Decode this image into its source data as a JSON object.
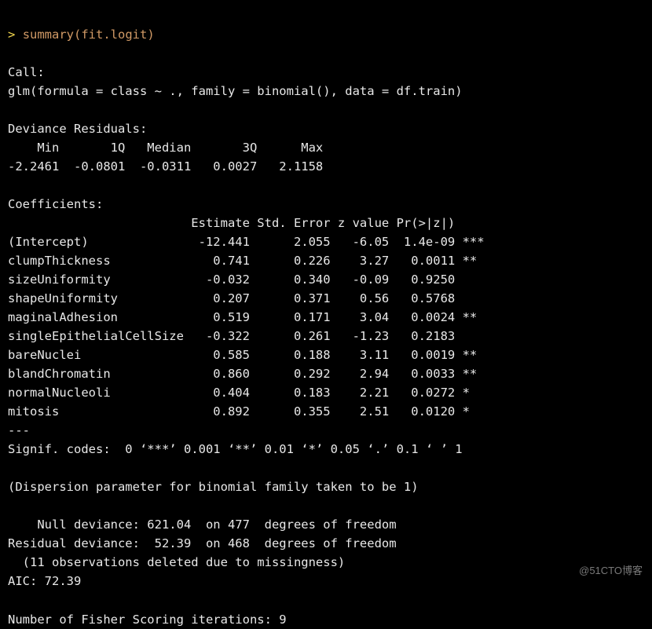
{
  "prompt": {
    "symbol": ">",
    "command": "summary(fit.logit)"
  },
  "call": {
    "header": "Call:",
    "formula": "glm(formula = class ~ ., family = binomial(), data = df.train)"
  },
  "devres": {
    "header": "Deviance Residuals: ",
    "labels": "    Min       1Q   Median       3Q      Max  ",
    "values": "-2.2461  -0.0801  -0.0311   0.0027   2.1158  "
  },
  "coef": {
    "header": "Coefficients:",
    "colhead": "                         Estimate Std. Error z value Pr(>|z|)    ",
    "rows": [
      "(Intercept)               -12.441      2.055   -6.05  1.4e-09 ***",
      "clumpThickness              0.741      0.226    3.27   0.0011 ** ",
      "sizeUniformity             -0.032      0.340   -0.09   0.9250    ",
      "shapeUniformity             0.207      0.371    0.56   0.5768    ",
      "maginalAdhesion             0.519      0.171    3.04   0.0024 ** ",
      "singleEpithelialCellSize   -0.322      0.261   -1.23   0.2183    ",
      "bareNuclei                  0.585      0.188    3.11   0.0019 ** ",
      "blandChromatin              0.860      0.292    2.94   0.0033 ** ",
      "normalNucleoli              0.404      0.183    2.21   0.0272 *  ",
      "mitosis                     0.892      0.355    2.51   0.0120 *  "
    ]
  },
  "signif": {
    "sep": "---",
    "codes": "Signif. codes:  0 ‘***’ 0.001 ‘**’ 0.01 ‘*’ 0.05 ‘.’ 0.1 ‘ ’ 1"
  },
  "deviance": {
    "disp": "(Dispersion parameter for binomial family taken to be 1)",
    "null": "    Null deviance: 621.04  on 477  degrees of freedom",
    "resid": "Residual deviance:  52.39  on 468  degrees of freedom",
    "missing": "  (11 observations deleted due to missingness)",
    "aic": "AIC: 72.39"
  },
  "fisher": {
    "line": "Number of Fisher Scoring iterations: 9"
  },
  "watermark": "@51CTO博客"
}
